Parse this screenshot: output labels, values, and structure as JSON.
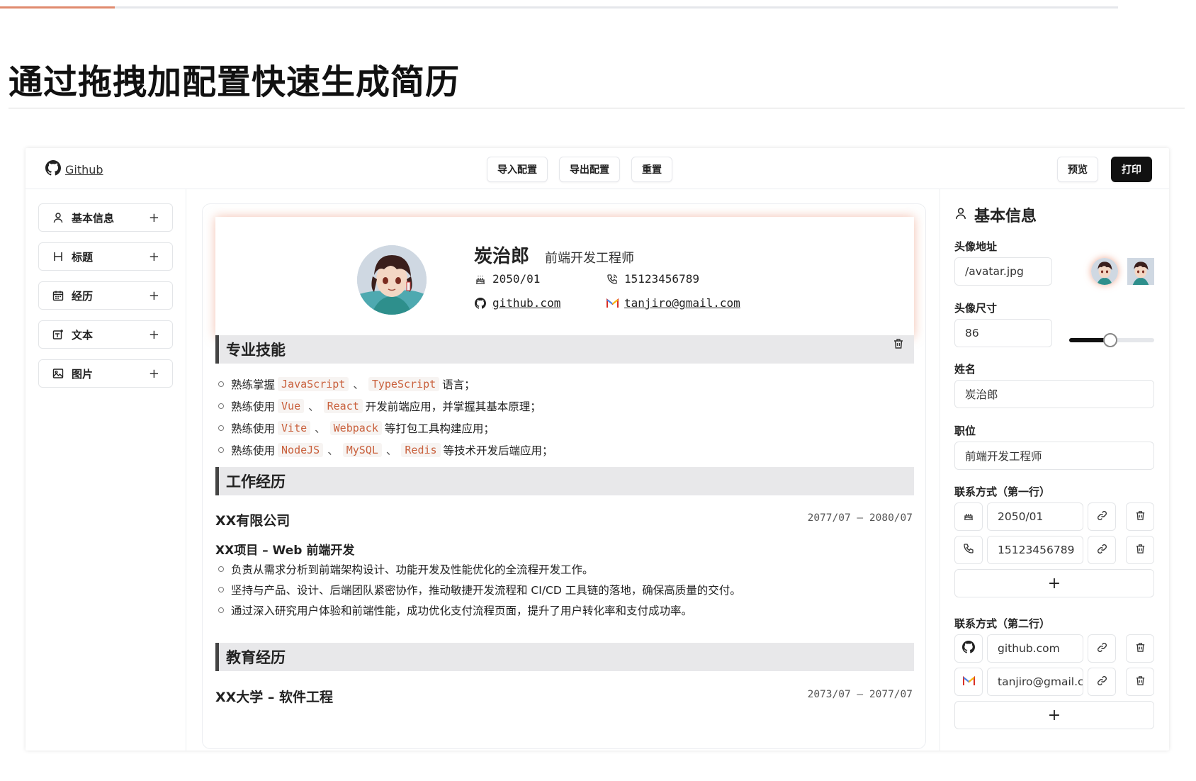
{
  "page": {
    "title": "通过拖拽加配置快速生成简历"
  },
  "toolbar": {
    "github_label": "Github",
    "import_label": "导入配置",
    "export_label": "导出配置",
    "reset_label": "重置",
    "preview_label": "预览",
    "print_label": "打印"
  },
  "blocks": [
    {
      "label": "基本信息",
      "icon": "user-icon"
    },
    {
      "label": "标题",
      "icon": "heading-icon"
    },
    {
      "label": "经历",
      "icon": "calendar-icon"
    },
    {
      "label": "文本",
      "icon": "text-icon"
    },
    {
      "label": "图片",
      "icon": "image-icon"
    }
  ],
  "resume": {
    "name": "炭治郎",
    "role": "前端开发工程师",
    "contacts_row1": [
      {
        "icon": "cake-icon",
        "text": "2050/01"
      },
      {
        "icon": "phone-icon",
        "text": "15123456789"
      }
    ],
    "contacts_row2": [
      {
        "icon": "github-icon",
        "text": "github.com"
      },
      {
        "icon": "gmail-icon",
        "text": "tanjiro@gmail.com"
      }
    ],
    "skills": {
      "heading": "专业技能",
      "items": [
        {
          "prefix": "熟练掌握",
          "tags": [
            "JavaScript",
            "TypeScript"
          ],
          "suffix": "语言；"
        },
        {
          "prefix": "熟练使用",
          "tags": [
            "Vue",
            "React"
          ],
          "suffix": "开发前端应用，并掌握其基本原理；"
        },
        {
          "prefix": "熟练使用",
          "tags": [
            "Vite",
            "Webpack"
          ],
          "suffix": "等打包工具构建应用；"
        },
        {
          "prefix": "熟练使用",
          "tags": [
            "NodeJS",
            "MySQL",
            "Redis"
          ],
          "suffix": "等技术开发后端应用；"
        }
      ],
      "separator": "、"
    },
    "work": {
      "heading": "工作经历",
      "company": "XX有限公司",
      "date": "2077/07 – 2080/07",
      "project": "XX项目 – Web 前端开发",
      "items": [
        "负责从需求分析到前端架构设计、功能开发及性能优化的全流程开发工作。",
        "坚持与产品、设计、后端团队紧密协作，推动敏捷开发流程和 CI/CD 工具链的落地，确保高质量的交付。",
        "通过深入研究用户体验和前端性能，成功优化支付流程页面，提升了用户转化率和支付成功率。"
      ]
    },
    "education": {
      "heading": "教育经历",
      "school": "XX大学 – 软件工程",
      "date": "2073/07 – 2077/07"
    }
  },
  "panel": {
    "title": "基本信息",
    "avatar_label": "头像地址",
    "avatar_value": "/avatar.jpg",
    "size_label": "头像尺寸",
    "size_value": "86",
    "size_fraction": 0.48,
    "name_label": "姓名",
    "name_value": "炭治郎",
    "role_label": "职位",
    "role_value": "前端开发工程师",
    "row1_label": "联系方式（第一行）",
    "row1": [
      {
        "icon": "cake-icon",
        "value": "2050/01"
      },
      {
        "icon": "phone-icon",
        "value": "15123456789"
      }
    ],
    "row2_label": "联系方式（第二行）",
    "row2": [
      {
        "icon": "github-icon",
        "value": "github.com"
      },
      {
        "icon": "gmail-icon",
        "value": "tanjiro@gmail.com"
      }
    ],
    "add_label": "+"
  },
  "colors": {
    "accent": "#e08a6e",
    "code": "#c9603c",
    "dark": "#111111"
  }
}
